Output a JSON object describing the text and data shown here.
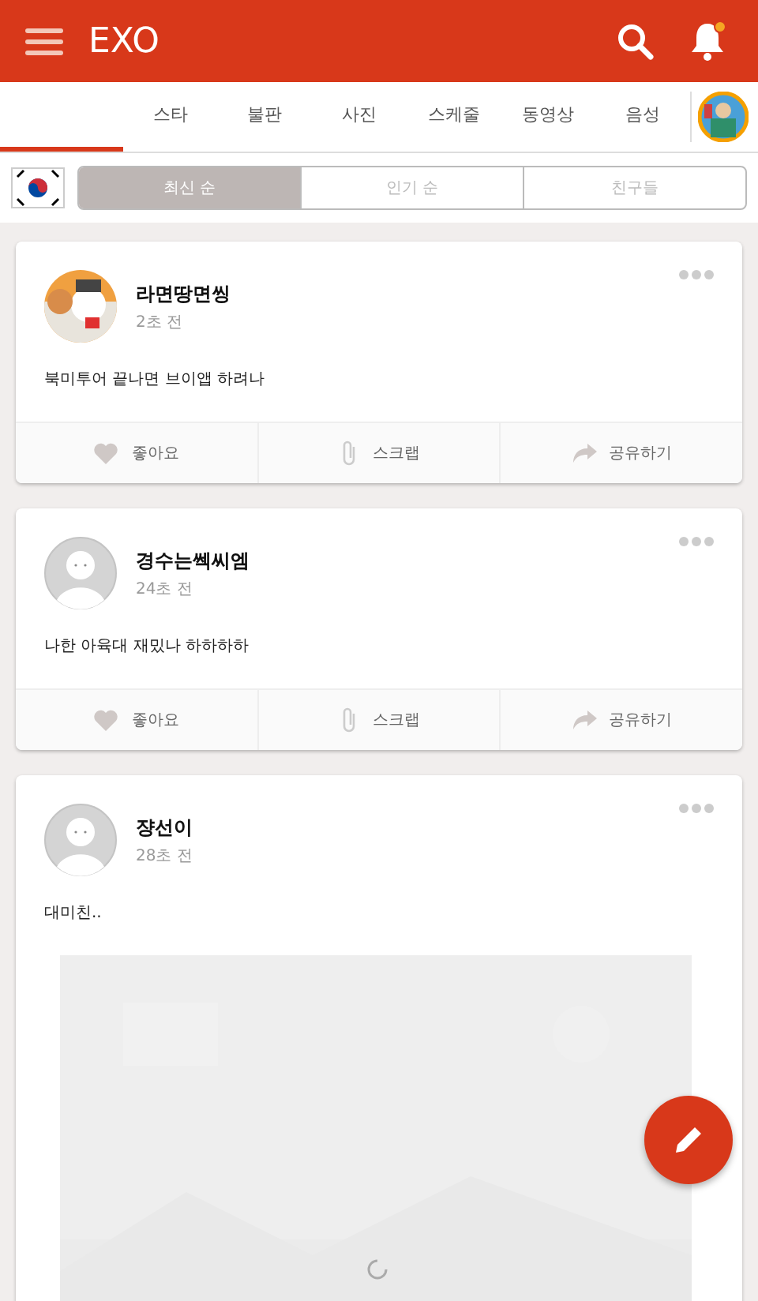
{
  "app_bar": {
    "title": "EXO",
    "notification_dot": true
  },
  "tabs": [
    {
      "selected": true
    },
    {
      "label": "스타",
      "selected": false
    },
    {
      "label": "불판",
      "selected": false
    },
    {
      "label": "사진",
      "selected": false
    },
    {
      "label": "스케줄",
      "selected": false
    },
    {
      "label": "동영상",
      "selected": false
    },
    {
      "label": "음성",
      "selected": false
    }
  ],
  "sort": [
    {
      "label": "최신 순",
      "selected": true
    },
    {
      "label": "인기 순",
      "selected": false
    },
    {
      "label": "친구들",
      "selected": false
    }
  ],
  "posts": [
    {
      "author": "라면땅면씽",
      "time": "2초 전",
      "avatar": {
        "kind": "picture"
      },
      "text": "북미투어 끝나면 브이앱 하려나",
      "actions": [
        "좋아요",
        "스크랩",
        "공유하기"
      ]
    },
    {
      "author": "경수는쎅씨엠",
      "time": "24초 전",
      "avatar": {
        "kind": "default"
      },
      "text": "나한 아육대 재밌나 하하하하",
      "actions": [
        "좋아요",
        "스크랩",
        "공유하기"
      ]
    },
    {
      "author": "쟝선이",
      "time": "28초 전",
      "avatar": {
        "kind": "default"
      },
      "text": "대미친..",
      "image": {
        "kind": "picture",
        "loading": true
      }
    }
  ]
}
